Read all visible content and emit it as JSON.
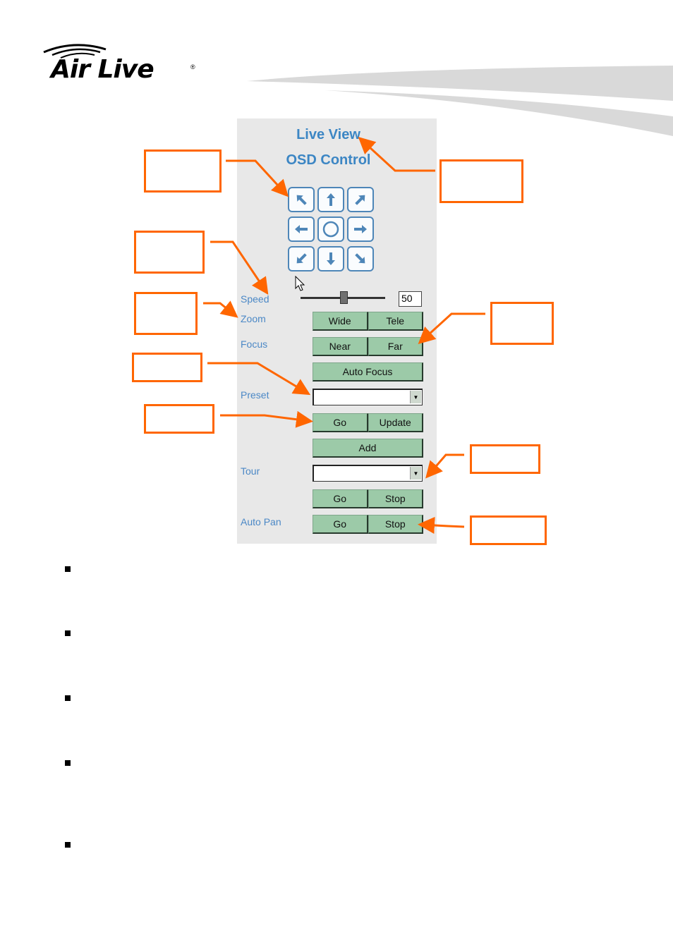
{
  "header": {
    "brand": "Air Live",
    "registered_mark": "®"
  },
  "panel": {
    "title": "Live View",
    "subtitle": "OSD Control",
    "ptz_pad": [
      {
        "name": "up-left"
      },
      {
        "name": "up"
      },
      {
        "name": "up-right"
      },
      {
        "name": "left"
      },
      {
        "name": "home"
      },
      {
        "name": "right"
      },
      {
        "name": "down-left"
      },
      {
        "name": "down"
      },
      {
        "name": "down-right"
      }
    ],
    "speed": {
      "label": "Speed",
      "value": "50",
      "slider_fraction": 0.5
    },
    "zoom": {
      "label": "Zoom",
      "wide": "Wide",
      "tele": "Tele"
    },
    "focus": {
      "label": "Focus",
      "near": "Near",
      "far": "Far",
      "auto": "Auto Focus"
    },
    "preset": {
      "label": "Preset",
      "selected": "",
      "go": "Go",
      "update": "Update",
      "add": "Add"
    },
    "tour": {
      "label": "Tour",
      "selected": "",
      "go": "Go",
      "stop": "Stop"
    },
    "auto_pan": {
      "label": "Auto Pan",
      "go": "Go",
      "stop": "Stop"
    }
  },
  "colors": {
    "callout": "#ff6600",
    "label_blue": "#4b88c6",
    "button_green": "#9ccaa8"
  },
  "callouts": [
    "",
    "",
    "",
    "",
    "",
    "",
    "",
    "",
    ""
  ],
  "bullets": [
    "",
    "",
    "",
    "",
    ""
  ]
}
